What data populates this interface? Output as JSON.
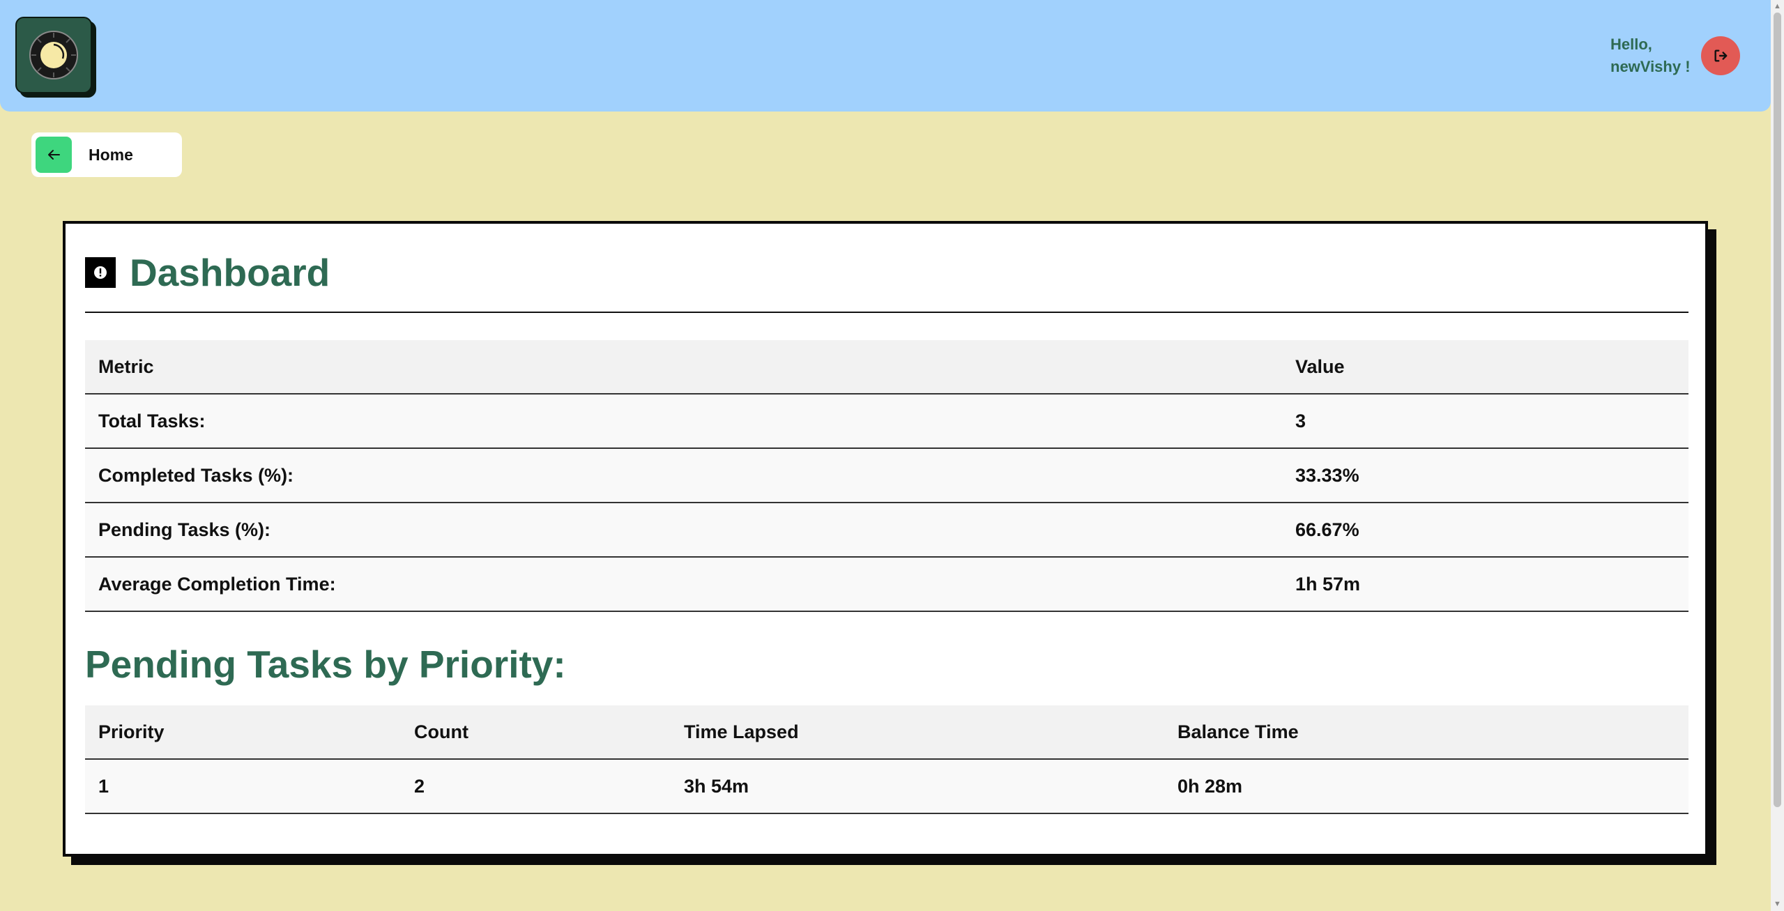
{
  "header": {
    "greeting_line1": "Hello,",
    "greeting_line2": "newVishy !",
    "logo_icon": "clock-dial-icon",
    "logout_icon": "sign-out-icon",
    "colors": {
      "header_bg": "#a1d1fd",
      "greeting_text": "#2e6a53",
      "logout_bg": "#e25a55"
    }
  },
  "nav": {
    "home_label": "Home",
    "home_icon": "arrow-left-icon",
    "home_icon_bg": "#3ed67e"
  },
  "dashboard": {
    "title": "Dashboard",
    "title_icon": "alert-circle-icon",
    "metrics": {
      "headers": [
        "Metric",
        "Value"
      ],
      "rows": [
        [
          "Total Tasks:",
          "3"
        ],
        [
          "Completed Tasks (%):",
          "33.33%"
        ],
        [
          "Pending Tasks (%):",
          "66.67%"
        ],
        [
          "Average Completion Time:",
          "1h 57m"
        ]
      ]
    },
    "pending_section_title": "Pending Tasks by Priority:",
    "priority": {
      "headers": [
        "Priority",
        "Count",
        "Time Lapsed",
        "Balance Time"
      ],
      "rows": [
        [
          "1",
          "2",
          "3h 54m",
          "0h 28m"
        ]
      ]
    }
  },
  "colors": {
    "page_bg": "#ede7b1",
    "title_color": "#2e6a53"
  }
}
